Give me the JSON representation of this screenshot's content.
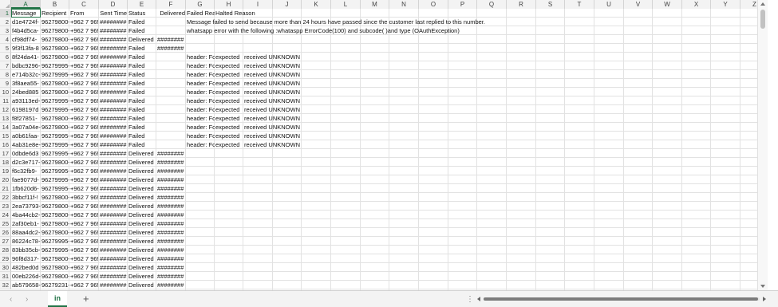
{
  "columns": [
    "A",
    "B",
    "C",
    "D",
    "E",
    "F",
    "G",
    "H",
    "I",
    "J",
    "K",
    "L",
    "M",
    "N",
    "O",
    "P",
    "Q",
    "R",
    "S",
    "T",
    "U",
    "V",
    "W",
    "X",
    "Y",
    "Z"
  ],
  "header_row": [
    "Message­­",
    "Recipient",
    "From",
    "Sent Time",
    "Status",
    "Delivered",
    "Failed Rea",
    "Halted Reason"
  ],
  "rows": [
    [
      "d1e4724f-",
      "96279800‑",
      "+962 7 96!",
      "########",
      "Failed",
      "",
      "Message failed to send because more than 24 hours have passed since the customer last replied to this number.",
      "",
      ""
    ],
    [
      "f4b4d5ca-",
      "96279800‑",
      "+962 7 96!",
      "########",
      "Failed",
      "",
      "whatsapp error with the following :whataspp ErrorCode(100) and subcode( )and type (OAuthException)",
      "",
      ""
    ],
    [
      "cf98df74-",
      "96279800‑",
      "+962 7 96!",
      "########",
      "Delivered",
      "########",
      "",
      "",
      ""
    ],
    [
      "9f3f13fa-8",
      "96279800‑",
      "+962 7 96!",
      "########",
      "Failed",
      "########",
      "",
      "",
      ""
    ],
    [
      "8f24da41-",
      "96279800‑",
      "+962 7 96!",
      "########",
      "Failed",
      "",
      "header: Fc",
      "expected",
      "received UNKNOWN"
    ],
    [
      "bdbc9296-",
      "96279995‑",
      "+962 7 96!",
      "########",
      "Failed",
      "",
      "header: Fc",
      "expected",
      "received UNKNOWN"
    ],
    [
      "e714b32c-",
      "96279995‑",
      "+962 7 96!",
      "########",
      "Failed",
      "",
      "header: Fc",
      "expected",
      "received UNKNOWN"
    ],
    [
      "3f8aea55-",
      "96279800‑",
      "+962 7 96!",
      "########",
      "Failed",
      "",
      "header: Fc",
      "expected",
      "received UNKNOWN"
    ],
    [
      "24bed885",
      "96279800‑",
      "+962 7 96!",
      "########",
      "Failed",
      "",
      "header: Fc",
      "expected",
      "received UNKNOWN"
    ],
    [
      "a93113ed-",
      "96279995‑",
      "+962 7 96!",
      "########",
      "Failed",
      "",
      "header: Fc",
      "expected",
      "received UNKNOWN"
    ],
    [
      "6198197d",
      "96279995‑",
      "+962 7 96!",
      "########",
      "Failed",
      "",
      "header: Fc",
      "expected",
      "received UNKNOWN"
    ],
    [
      "f8f27851-",
      "96279800‑",
      "+962 7 96!",
      "########",
      "Failed",
      "",
      "header: Fc",
      "expected",
      "received UNKNOWN"
    ],
    [
      "3a07a04e-",
      "96279800‑",
      "+962 7 96!",
      "########",
      "Failed",
      "",
      "header: Fc",
      "expected",
      "received UNKNOWN"
    ],
    [
      "a0b61faa-",
      "96279995‑",
      "+962 7 96!",
      "########",
      "Failed",
      "",
      "header: Fc",
      "expected",
      "received UNKNOWN"
    ],
    [
      "4ab31e8e-",
      "96279995‑",
      "+962 7 96!",
      "########",
      "Failed",
      "",
      "header: Fc",
      "expected",
      "received UNKNOWN"
    ],
    [
      "0dbde6d3",
      "96279995‑",
      "+962 7 96!",
      "########",
      "Delivered",
      "########",
      "",
      "",
      ""
    ],
    [
      "d2c3e717-",
      "96279800‑",
      "+962 7 96!",
      "########",
      "Delivered",
      "########",
      "",
      "",
      ""
    ],
    [
      "f6c32fb9-",
      "96279995‑",
      "+962 7 96!",
      "########",
      "Delivered",
      "########",
      "",
      "",
      ""
    ],
    [
      "fae9077d-",
      "96279995‑",
      "+962 7 96!",
      "########",
      "Delivered",
      "########",
      "",
      "",
      ""
    ],
    [
      "1fb620d6-",
      "96279995‑",
      "+962 7 96!",
      "########",
      "Delivered",
      "########",
      "",
      "",
      ""
    ],
    [
      "3bbcf11f-!",
      "96279800‑",
      "+962 7 96!",
      "########",
      "Delivered",
      "########",
      "",
      "",
      ""
    ],
    [
      "2ea73793-",
      "96279800‑",
      "+962 7 96!",
      "########",
      "Delivered",
      "########",
      "",
      "",
      ""
    ],
    [
      "4ba44cb2-",
      "96279800‑",
      "+962 7 96!",
      "########",
      "Delivered",
      "########",
      "",
      "",
      ""
    ],
    [
      "2af30eb1-",
      "96279800‑",
      "+962 7 96!",
      "########",
      "Delivered",
      "########",
      "",
      "",
      ""
    ],
    [
      "88aa4dc2-",
      "96279800‑",
      "+962 7 96!",
      "########",
      "Delivered",
      "########",
      "",
      "",
      ""
    ],
    [
      "86224c78-",
      "96279995‑",
      "+962 7 96!",
      "########",
      "Delivered",
      "########",
      "",
      "",
      ""
    ],
    [
      "83bb35cb-",
      "96279995‑",
      "+962 7 96!",
      "########",
      "Delivered",
      "########",
      "",
      "",
      ""
    ],
    [
      "96f8d317-",
      "96279800‑",
      "+962 7 96!",
      "########",
      "Delivered",
      "########",
      "",
      "",
      ""
    ],
    [
      "482bed0d",
      "96279800‑",
      "+962 7 96!",
      "########",
      "Delivered",
      "########",
      "",
      "",
      ""
    ],
    [
      "00eb226d-",
      "96279800‑",
      "+962 7 96!",
      "########",
      "Delivered",
      "########",
      "",
      "",
      ""
    ],
    [
      "ab579658-",
      "96279231‑",
      "+962 7 96!",
      "########",
      "Delivered",
      "########",
      "",
      "",
      ""
    ]
  ],
  "row_numbers": [
    "1",
    "2",
    "3",
    "4",
    "5",
    "6",
    "7",
    "8",
    "9",
    "10",
    "11",
    "12",
    "13",
    "14",
    "15",
    "16",
    "17",
    "18",
    "19",
    "20",
    "21",
    "22",
    "23",
    "24",
    "25",
    "26",
    "27",
    "28",
    "29",
    "30",
    "31",
    "32"
  ],
  "tabbar": {
    "prev_label": "‹",
    "next_label": "›",
    "sheet_tab": "in",
    "add_sheet": "+",
    "split_handle": "⋮"
  },
  "colors": {
    "accent": "#217346",
    "grid": "#e2e2e2",
    "header_bg": "#f3f3f3"
  }
}
